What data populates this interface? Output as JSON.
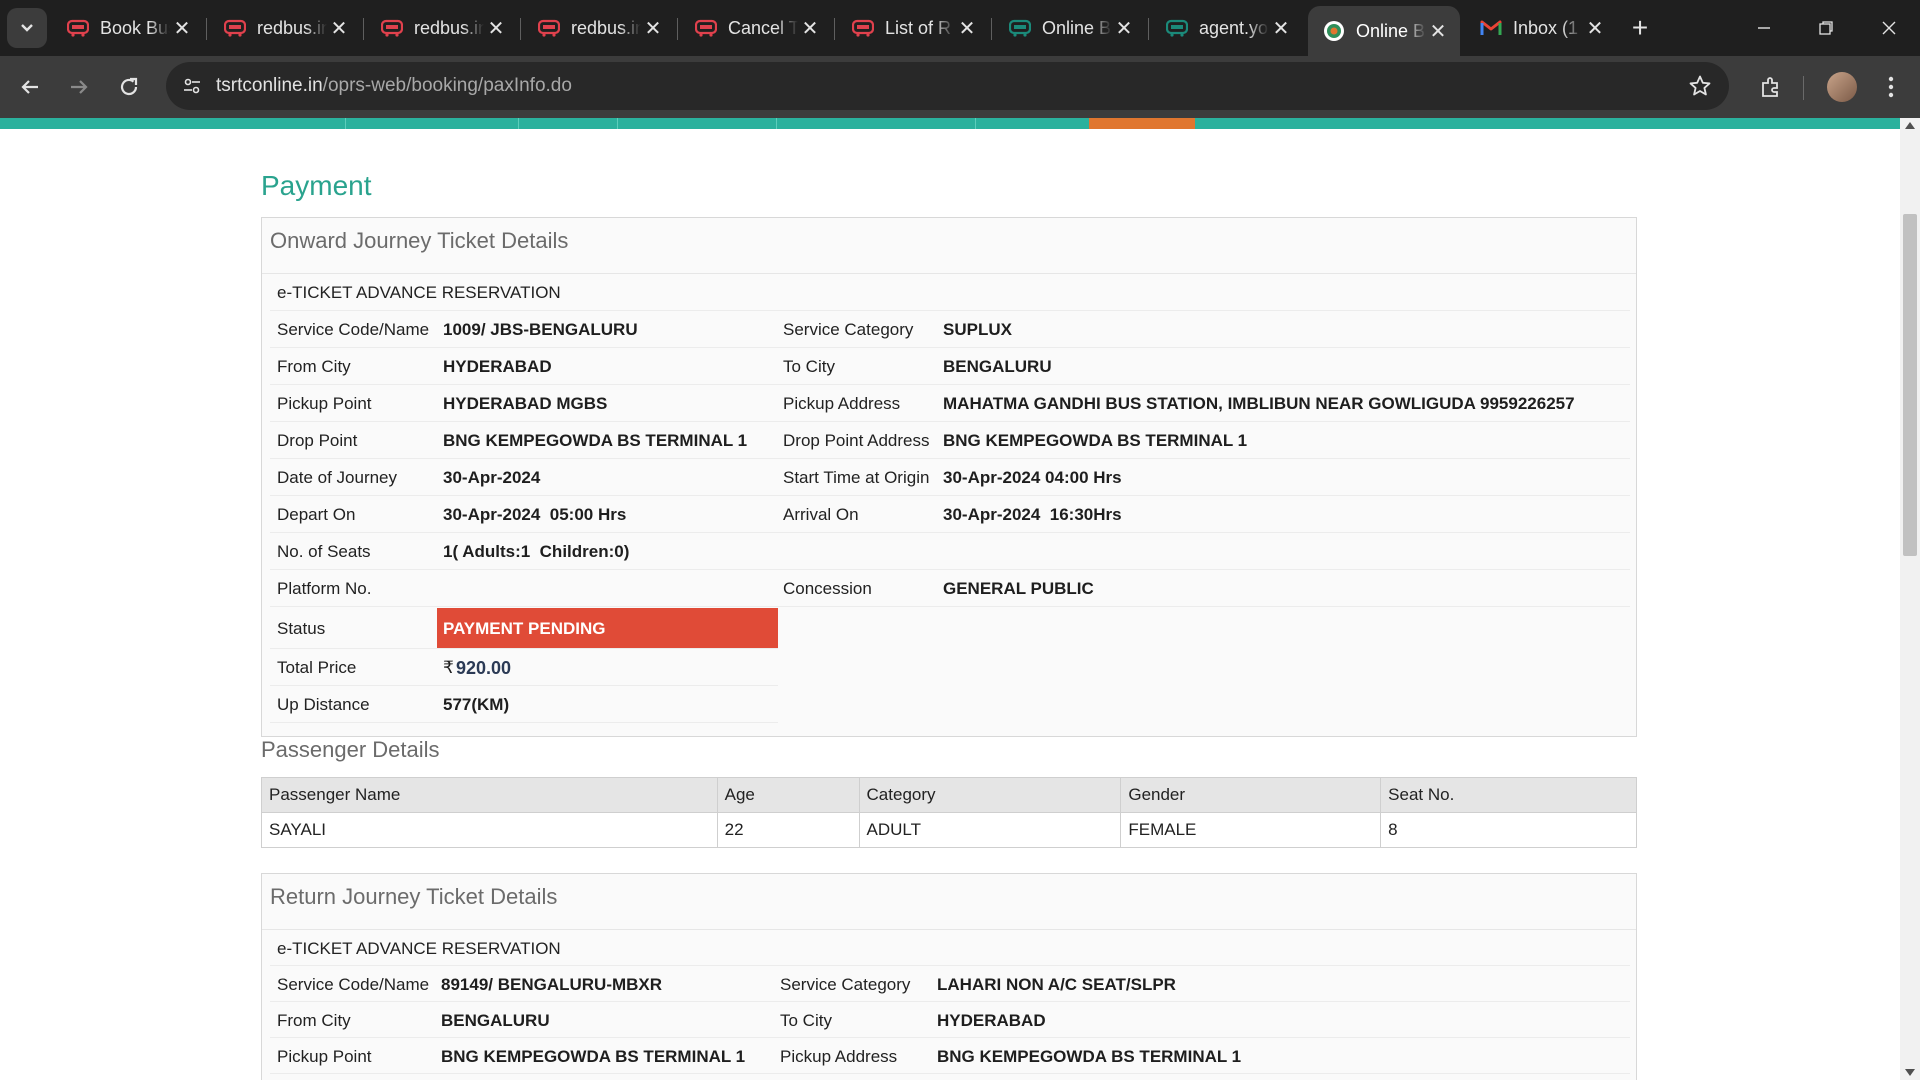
{
  "browser": {
    "tabs": [
      {
        "title": "Book Bus",
        "icon": "bus-icon"
      },
      {
        "title": "redbus.in",
        "icon": "bus-icon"
      },
      {
        "title": "redbus.in",
        "icon": "bus-icon"
      },
      {
        "title": "redbus.in",
        "icon": "bus-icon"
      },
      {
        "title": "Cancel T",
        "icon": "bus-icon"
      },
      {
        "title": "List of R",
        "icon": "bus-icon"
      },
      {
        "title": "Online B",
        "icon": "bus-icon"
      },
      {
        "title": "agent.yo",
        "icon": "bus-icon"
      },
      {
        "title": "Online B",
        "icon": "tsrtc-logo-icon",
        "active": true
      },
      {
        "title": "Inbox (1",
        "icon": "gmail-icon"
      }
    ],
    "url_host": "tsrtconline.in",
    "url_path": "/oprs-web/booking/paxInfo.do",
    "colors": {
      "chrome_dark": "#1f1f1f",
      "toolbar": "#3c3c3c",
      "bus_icon_red": "#e0414d",
      "teal_icon": "#1b8a7a"
    }
  },
  "page": {
    "heading": "Payment",
    "colors": {
      "accent_teal": "#2aa38e",
      "nav_stripe": "#2ab19d",
      "nav_active": "#e0762f",
      "status_red": "#e04b37"
    },
    "onward": {
      "title": "Onward Journey Ticket Details",
      "ticket_type": "e-TICKET ADVANCE RESERVATION",
      "service_code_label": "Service Code/Name",
      "service_code": "1009/ JBS-BENGALURU",
      "service_category_label": "Service Category",
      "service_category": "SUPLUX",
      "from_city_label": "From City",
      "from_city": "HYDERABAD",
      "to_city_label": "To City",
      "to_city": "BENGALURU",
      "pickup_point_label": "Pickup Point",
      "pickup_point": "HYDERABAD MGBS",
      "pickup_address_label": "Pickup Address",
      "pickup_address": "MAHATMA GANDHI BUS STATION, IMBLIBUN NEAR GOWLIGUDA 9959226257",
      "drop_point_label": "Drop Point",
      "drop_point": "BNG KEMPEGOWDA BS TERMINAL 1",
      "drop_address_label": "Drop Point Address",
      "drop_address": "BNG KEMPEGOWDA BS TERMINAL 1",
      "doj_label": "Date of Journey",
      "doj": "30-Apr-2024",
      "start_time_label": "Start Time at Origin",
      "start_time": "30-Apr-2024 04:00 Hrs",
      "depart_label": "Depart On",
      "depart": "30-Apr-2024  05:00 Hrs",
      "arrival_label": "Arrival On",
      "arrival": "30-Apr-2024  16:30Hrs",
      "seats_label": "No. of Seats",
      "seats": "1( Adults:1  Children:0)",
      "platform_label": "Platform No.",
      "platform": "",
      "concession_label": "Concession",
      "concession": "GENERAL PUBLIC",
      "status_label": "Status",
      "status": "PAYMENT PENDING",
      "total_price_label": "Total Price",
      "currency": "₹",
      "total_price": "920.00",
      "up_distance_label": "Up Distance",
      "up_distance": "577(KM)"
    },
    "passenger": {
      "title": "Passenger Details",
      "headers": [
        "Passenger Name",
        "Age",
        "Category",
        "Gender",
        "Seat No."
      ],
      "rows": [
        [
          "SAYALI",
          "22",
          "ADULT",
          "FEMALE",
          "8"
        ]
      ]
    },
    "return": {
      "title": "Return Journey Ticket Details",
      "ticket_type": "e-TICKET ADVANCE RESERVATION",
      "service_code_label": "Service Code/Name",
      "service_code": "89149/ BENGALURU-MBXR",
      "service_category_label": "Service Category",
      "service_category": "LAHARI NON A/C SEAT/SLPR",
      "from_city_label": "From City",
      "from_city": "BENGALURU",
      "to_city_label": "To City",
      "to_city": "HYDERABAD",
      "pickup_point_label": "Pickup Point",
      "pickup_point": "BNG KEMPEGOWDA BS TERMINAL 1",
      "pickup_address_label": "Pickup Address",
      "pickup_address": "BNG KEMPEGOWDA BS TERMINAL 1"
    }
  }
}
